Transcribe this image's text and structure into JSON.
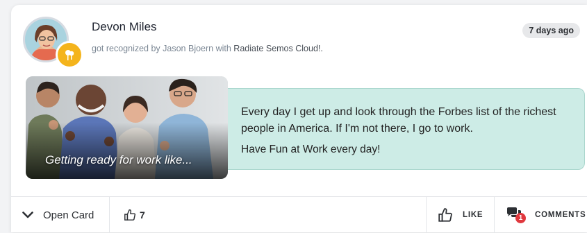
{
  "post": {
    "user_name": "Devon Miles",
    "recognition_prefix": "got recognized by Jason Bjoern with",
    "award_name": "Radiate Semos Cloud!.",
    "timestamp": "7 days ago",
    "image_caption": "Getting ready for work like...",
    "message_line1": "Every day I get up and look through the Forbes list of the richest people in America. If I'm not there, I go to work.",
    "message_line2": "Have Fun at Work every day!"
  },
  "footer": {
    "open_card_label": "Open Card",
    "like_count": "7",
    "like_label": "LIKE",
    "comments_label": "COMMENTS",
    "comments_count": "1"
  },
  "icons": {
    "avatar_badge": "award-badge-icon",
    "open_card": "chevron-down-icon",
    "like": "thumbs-up-icon",
    "comments": "comments-icon"
  },
  "colors": {
    "message_bg": "#cdece6",
    "badge": "#f4b41c",
    "comment_count": "#e0383e"
  }
}
